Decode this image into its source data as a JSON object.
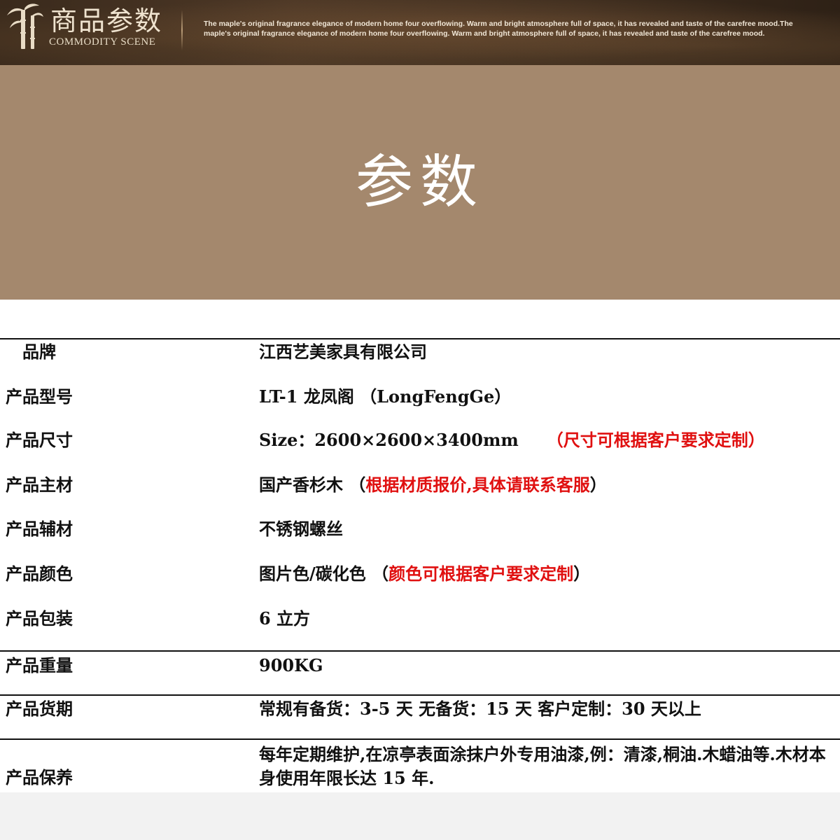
{
  "banner": {
    "title": "商品参数",
    "subtitle": "COMMODITY SCENE",
    "description": "The maple's original fragrance elegance of modern home four overflowing. Warm and bright atmosphere full of space, it has revealed and taste of the carefree mood.The maple's original fragrance elegance of modern home four overflowing. Warm and bright atmosphere full of space, it has revealed and taste of the carefree mood.",
    "logo_icon": "bamboo-icon"
  },
  "heading": {
    "text": "参数"
  },
  "colors": {
    "banner_bg": "#3f2e1f",
    "heading_bg": "#a4886d",
    "accent_red": "#e01010",
    "text": "#111111"
  },
  "params": [
    {
      "label": "品牌",
      "value": "江西艺美家具有限公司",
      "note": ""
    },
    {
      "label": "产品型号",
      "value": "LT-1  龙凤阁 （LongFengGe）",
      "note": ""
    },
    {
      "label": "产品尺寸",
      "value": "Size：2600×2600×3400mm",
      "note": "（尺寸可根据客户要求定制）"
    },
    {
      "label": "产品主材",
      "value": "国产香杉木 （",
      "note": "根据材质报价,具体请联系客服",
      "value_tail": "）"
    },
    {
      "label": "产品辅材",
      "value": "不锈钢螺丝",
      "note": ""
    },
    {
      "label": "产品颜色",
      "value": "图片色/碳化色  （",
      "note": "颜色可根据客户要求定制",
      "value_tail": "）"
    },
    {
      "label": "产品包装",
      "value": "6 立方",
      "note": ""
    },
    {
      "label": "产品重量",
      "value": "900KG",
      "note": ""
    },
    {
      "label": "产品货期",
      "value": "常规有备货：3-5 天     无备货：15 天   客户定制：30 天以上",
      "note": ""
    },
    {
      "label": "产品保养",
      "value": "每年定期维护,在凉亭表面涂抹户外专用油漆,例：清漆,桐油.木蜡油等.木材本身使用年限长达 15 年.",
      "note": ""
    }
  ]
}
